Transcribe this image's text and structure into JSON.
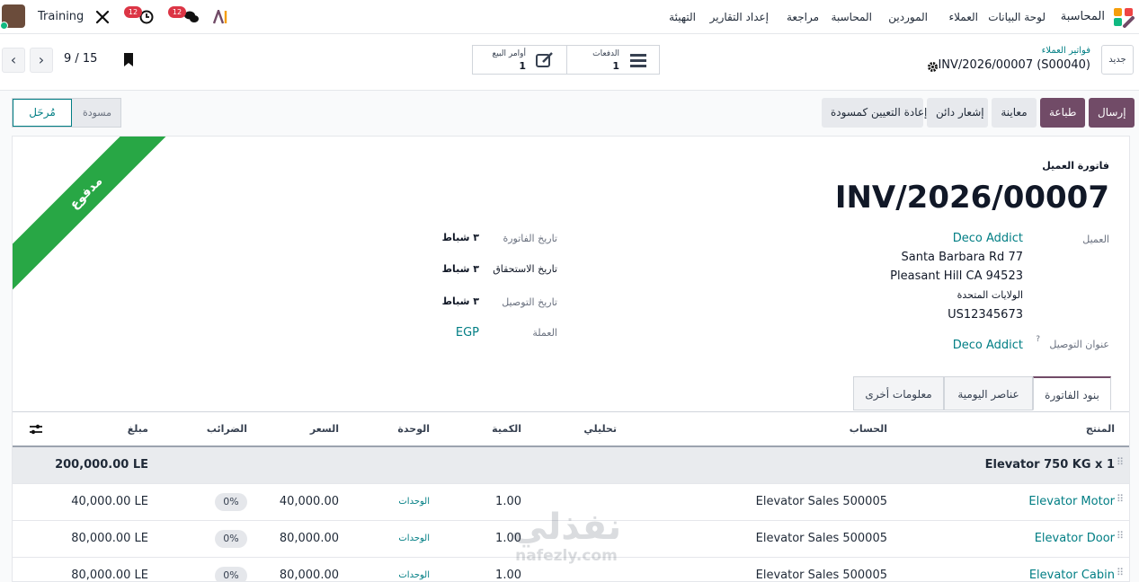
{
  "topbar": {
    "menu": [
      "المحاسبة",
      "لوحة البيانات",
      "العملاء",
      "الموردين",
      "المحاسبة",
      "مراجعة",
      "إعداد التقارير",
      "التهيئة"
    ],
    "company": "Training",
    "chat_badge": "12",
    "activity_badge": "12"
  },
  "controlpanel": {
    "new_label": "جديد",
    "breadcrumb_parent": "فواتير العملاء",
    "record_title": "INV/2026/00007 (S00040)",
    "pager": "9 / 15",
    "smart_payments_label": "الدفعات",
    "smart_payments_count": "1",
    "smart_orders_label": "أوامر البيع",
    "smart_orders_count": "1"
  },
  "actions": {
    "send": "إرسال",
    "print": "طباعة",
    "preview": "معاينة",
    "credit_note": "إشعار دائن",
    "reset_draft": "إعادة التعيين كمسودة"
  },
  "status": {
    "posted": "مُرحَل",
    "draft": "مسودة"
  },
  "sheet": {
    "ribbon": "مدفوع",
    "doc_type": "فاتورة العميل",
    "number": "INV/2026/00007",
    "customer_label": "العميل",
    "customer_name": "Deco Addict",
    "address_line1": "Santa Barbara Rd 77",
    "address_line2": "Pleasant Hill CA 94523",
    "address_line3": "الولايات المتحدة",
    "address_line4": "US12345673",
    "delivery_label": "عنوان التوصيل",
    "delivery_help": "?",
    "delivery_value": "Deco Addict",
    "invoice_date_label": "تاريخ الفاتورة",
    "invoice_date": "٣ شباط",
    "due_date_label": "تاريخ الاستحقاق",
    "due_date": "٣ شباط",
    "delivery_date_label": "تاريخ التوصيل",
    "delivery_date": "٣ شباط",
    "currency_label": "العملة",
    "currency": "EGP"
  },
  "tabs": [
    "بنود الفاتورة",
    "عناصر اليومية",
    "معلومات أخرى"
  ],
  "table": {
    "headers": {
      "product": "المنتج",
      "account": "الحساب",
      "analytic": "تحليلي",
      "quantity": "الكمية",
      "uom": "الوحدة",
      "price": "السعر",
      "taxes": "الضرائب",
      "amount": "مبلغ"
    },
    "section": {
      "name": "Elevator 750 KG x 1",
      "subtotal": "200,000.00 LE"
    },
    "rows": [
      {
        "product": "Elevator Motor",
        "account": "Elevator Sales 500005",
        "quantity": "1.00",
        "uom": "الوحدات",
        "price": "40,000.00",
        "tax": "0%",
        "amount": "40,000.00 LE"
      },
      {
        "product": "Elevator Door",
        "account": "Elevator Sales 500005",
        "quantity": "1.00",
        "uom": "الوحدات",
        "price": "80,000.00",
        "tax": "0%",
        "amount": "80,000.00 LE"
      },
      {
        "product": "Elevator Cabin",
        "account": "Elevator Sales 500005",
        "quantity": "1.00",
        "uom": "الوحدات",
        "price": "80,000.00",
        "tax": "0%",
        "amount": "80,000.00 LE"
      }
    ]
  },
  "watermark": {
    "arabic": "نفذلي",
    "latin": "nafezly.com"
  },
  "colors": {
    "brand": "#714b67",
    "link": "#017e84",
    "paid": "#28a745",
    "badge": "#dc3545"
  }
}
